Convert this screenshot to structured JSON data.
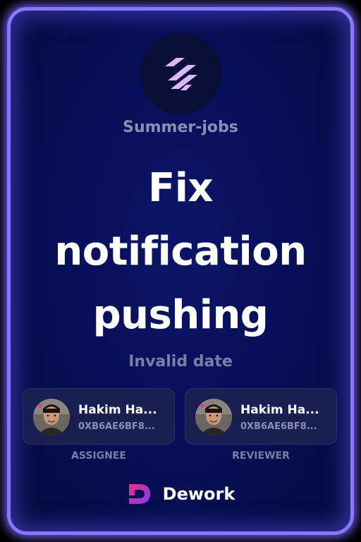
{
  "organization": {
    "name": "Summer-jobs",
    "logo_icon": "stacked-bars-icon",
    "logo_color": "#d9b8ff"
  },
  "task": {
    "title_lines": [
      "Fix",
      "notification",
      "pushing"
    ],
    "date": "Invalid date"
  },
  "assignee": {
    "name": "Hakim Ha...",
    "address": "0XB6AE6BF8...",
    "role": "ASSIGNEE",
    "avatar_icon": "user-avatar"
  },
  "reviewer": {
    "name": "Hakim Ha...",
    "address": "0XB6AE6BF8...",
    "role": "REVIEWER",
    "avatar_icon": "user-avatar"
  },
  "brand": {
    "name": "Dework",
    "logo_icon": "dework-logo-icon",
    "gradient": [
      "#f0307a",
      "#7a3cff"
    ]
  },
  "theme": {
    "border": "#8878ff",
    "background": "#08105a"
  }
}
